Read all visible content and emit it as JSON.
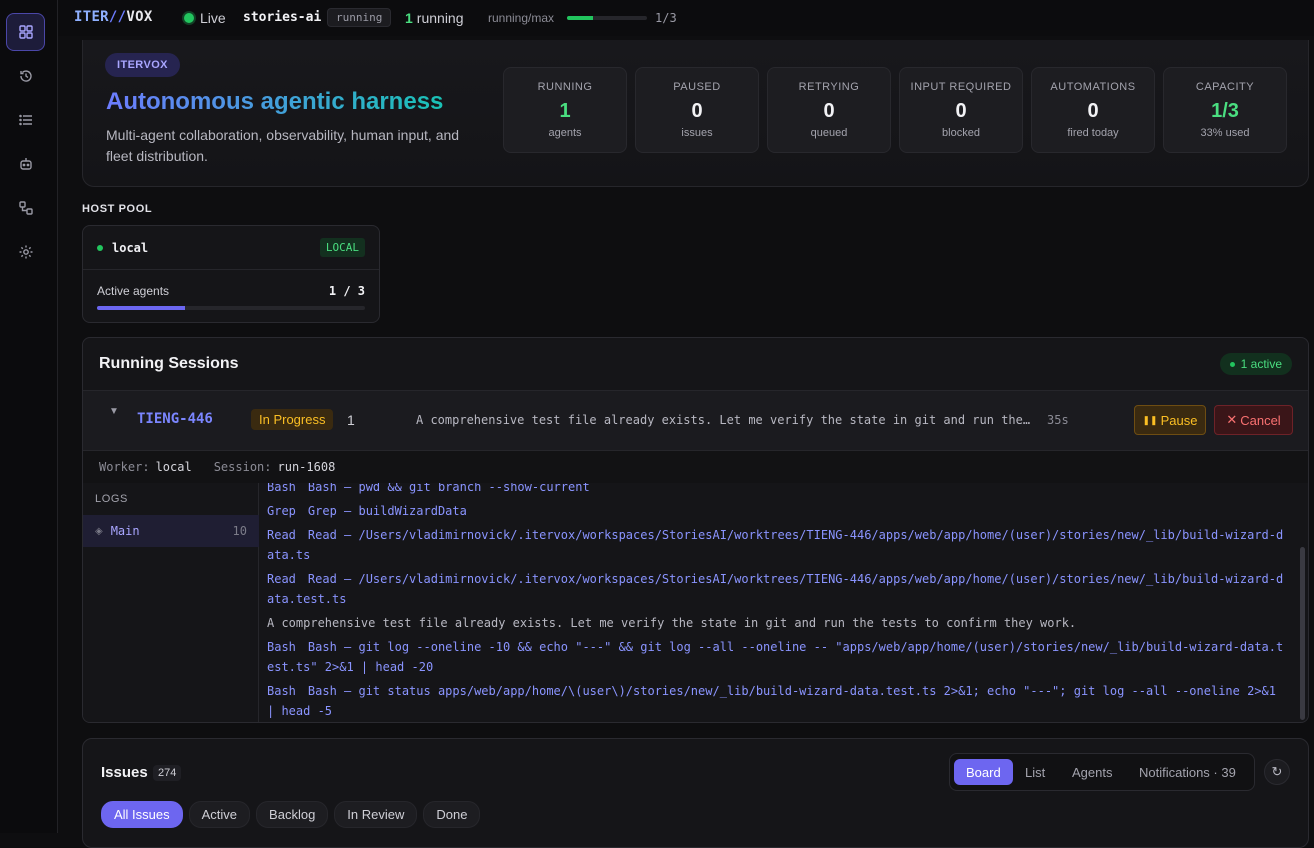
{
  "topbar": {
    "brand_a": "ITER",
    "brand_b": "//",
    "brand_c": "VOX",
    "live_label": "Live",
    "project": "stories-ai",
    "state": "running",
    "running_count": "1",
    "running_label": "running",
    "ratio_label": "running/max",
    "ratio_value": "1/3",
    "ratio_fraction": 0.33
  },
  "hero": {
    "tag": "ITERVOX",
    "title": "Autonomous agentic harness",
    "subtitle": "Multi-agent collaboration, observability, human input, and fleet distribution.",
    "stats": [
      {
        "label": "RUNNING",
        "value": "1",
        "sub": "agents",
        "accent": true
      },
      {
        "label": "PAUSED",
        "value": "0",
        "sub": "issues",
        "accent": false
      },
      {
        "label": "RETRYING",
        "value": "0",
        "sub": "queued",
        "accent": false
      },
      {
        "label": "INPUT REQUIRED",
        "value": "0",
        "sub": "blocked",
        "accent": false
      },
      {
        "label": "AUTOMATIONS",
        "value": "0",
        "sub": "fired today",
        "accent": false
      },
      {
        "label": "CAPACITY",
        "value": "1/3",
        "sub": "33% used",
        "accent": true
      }
    ]
  },
  "host_pool": {
    "title": "HOST POOL",
    "host_name": "local",
    "badge": "LOCAL",
    "active_label": "Active agents",
    "active_value": "1 / 3",
    "active_fraction": 0.33
  },
  "sessions": {
    "title": "Running Sessions",
    "active_badge": "1 active",
    "row": {
      "issue_id": "TIENG-446",
      "status": "In Progress",
      "turns": "1",
      "last_message": "A comprehensive test file already exists. Let me verify the state in git and run the tests to confirm they work.",
      "elapsed": "35s",
      "pause_label": "Pause",
      "cancel_label": "Cancel"
    },
    "meta": {
      "worker_label": "Worker:",
      "worker_value": "local",
      "session_label": "Session:",
      "session_value": "run-1608"
    },
    "logs": {
      "label": "LOGS",
      "item_name": "Main",
      "item_count": "10",
      "lines": [
        {
          "tool": "Bash",
          "text": "Bash — pwd && git branch --show-current"
        },
        {
          "tool": "Grep",
          "text": "Grep — buildWizardData"
        },
        {
          "tool": "Read",
          "text": "Read — /Users/vladimirnovick/.itervox/workspaces/StoriesAI/worktrees/TIENG-446/apps/web/app/home/(user)/stories/new/_lib/build-wizard-data.ts"
        },
        {
          "tool": "Read",
          "text": "Read — /Users/vladimirnovick/.itervox/workspaces/StoriesAI/worktrees/TIENG-446/apps/web/app/home/(user)/stories/new/_lib/build-wizard-data.test.ts"
        },
        {
          "tool": "",
          "text": "A comprehensive test file already exists. Let me verify the state in git and run the tests to confirm they work."
        },
        {
          "tool": "Bash",
          "text": "Bash — git log --oneline -10 && echo \"---\" && git log --all --oneline -- \"apps/web/app/home/(user)/stories/new/_lib/build-wizard-data.test.ts\" 2>&1 | head -20"
        },
        {
          "tool": "Bash",
          "text": "Bash — git status apps/web/app/home/\\(user\\)/stories/new/_lib/build-wizard-data.test.ts 2>&1; echo \"---\"; git log --all --oneline 2>&1 | head -5"
        }
      ]
    }
  },
  "issues": {
    "title": "Issues",
    "count": "274",
    "view_tabs": [
      "Board",
      "List",
      "Agents",
      "Notifications · 39"
    ],
    "filters": [
      "All Issues",
      "Active",
      "Backlog",
      "In Review",
      "Done"
    ]
  },
  "colors": {
    "accent": "#6d66f0",
    "success": "#22c55e",
    "warning": "#fbbf24",
    "danger": "#f87171"
  }
}
